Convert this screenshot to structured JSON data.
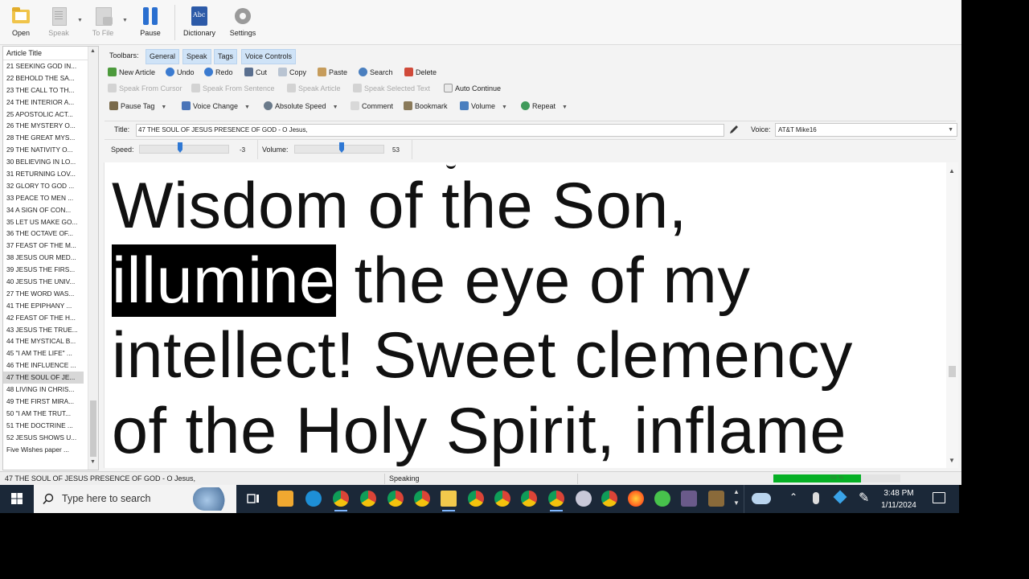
{
  "ribbon": {
    "open": "Open",
    "speak": "Speak",
    "to_file": "To File",
    "pause": "Pause",
    "dictionary": "Dictionary",
    "settings": "Settings"
  },
  "list": {
    "header": "Article Title",
    "items": [
      "21 SEEKING GOD IN...",
      "22 BEHOLD THE SA...",
      "23 THE CALL TO TH...",
      "24 THE INTERIOR A...",
      "25 APOSTOLIC ACT...",
      "26 THE MYSTERY O...",
      "28 THE GREAT MYS...",
      "29 THE NATIVITY O...",
      "30 BELIEVING IN LO...",
      "31 RETURNING LOV...",
      "32 GLORY TO GOD ...",
      "33 PEACE TO MEN ...",
      "34 A SIGN OF CON...",
      "35 LET US MAKE GO...",
      "36 THE OCTAVE OF...",
      "37 FEAST OF THE M...",
      "38 JESUS OUR MED...",
      "39 JESUS THE FIRS...",
      "40 JESUS THE UNIV...",
      "27 THE WORD WAS...",
      "41 THE EPIPHANY ...",
      "42 FEAST OF THE H...",
      "43 JESUS THE TRUE...",
      "44 THE MYSTICAL B...",
      "45 \"I AM THE LIFE\" ...",
      "46 THE INFLUENCE ...",
      "47 THE SOUL OF JE...",
      "48 LIVING IN CHRIS...",
      "49 THE FIRST MIRA...",
      "50 \"I AM THE TRUT...",
      "51 THE DOCTRINE ...",
      "52 JESUS SHOWS U...",
      "Five Wishes paper ..."
    ],
    "selected_index": 26
  },
  "toolbars": {
    "label": "Toolbars:",
    "tabs": [
      "General",
      "Speak",
      "Tags",
      "Voice Controls"
    ]
  },
  "row1": [
    "New Article",
    "Undo",
    "Redo",
    "Cut",
    "Copy",
    "Paste",
    "Search",
    "Delete"
  ],
  "row2": [
    "Speak From Cursor",
    "Speak From Sentence",
    "Speak Article",
    "Speak Selected Text",
    "Auto Continue"
  ],
  "row3": [
    "Pause Tag",
    "Voice Change",
    "Absolute Speed",
    "Comment",
    "Bookmark",
    "Volume",
    "Repeat"
  ],
  "title_bar": {
    "label": "Title:",
    "value": "47 THE SOUL OF JESUS PRESENCE OF GOD - O Jesus,",
    "voice_label": "Voice:",
    "voice_value": "AT&T Mike16"
  },
  "sliders": {
    "speed_label": "Speed:",
    "speed_value": "-3",
    "volume_label": "Volume:",
    "volume_value": "53"
  },
  "reader": {
    "line1": "Wisdom of the Son,",
    "highlight": "illumine",
    "line2_rest": " the eye of my",
    "line3": "intellect! Sweet clemency",
    "line4": "of the Holy Spirit, inflame"
  },
  "status": {
    "title": "47 THE SOUL OF JESUS PRESENCE OF GOD - O Jesus,",
    "state": "Speaking",
    "progress_text": "69 %",
    "progress": 0.69
  },
  "taskbar": {
    "search_placeholder": "Type here to search",
    "time": "3:48 PM",
    "date": "1/11/2024"
  },
  "colors": {
    "accent_tab": "#cfe3f7",
    "progress_fill": "#06b025",
    "highlight_bg": "#000000",
    "taskbar_bg": "#1b2838"
  }
}
